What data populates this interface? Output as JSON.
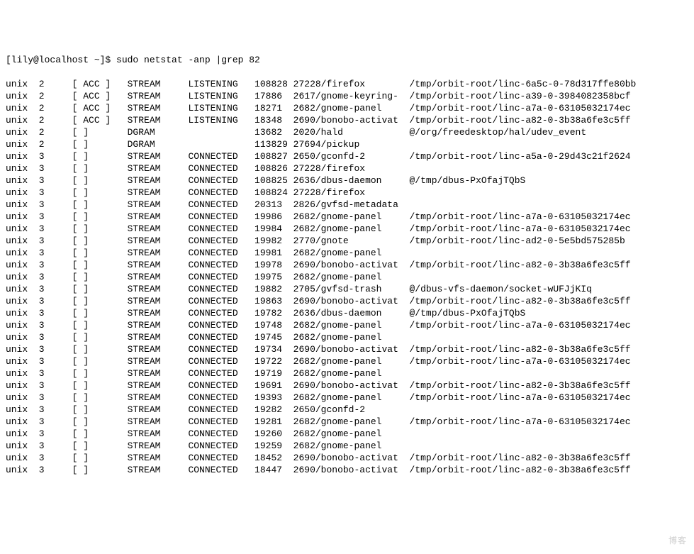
{
  "prompt": "[lily@localhost ~]$ sudo netstat -anp |grep 82",
  "columns": {
    "proto_w": 6,
    "refcnt_w": 3,
    "flags_w": 10,
    "type_w": 11,
    "state_w": 12,
    "inode_w": 7,
    "proc_w": 21
  },
  "rows": [
    {
      "proto": "unix",
      "refcnt": "2",
      "flags": "[ ACC ]",
      "type": "STREAM",
      "state": "LISTENING",
      "inode": "108828",
      "proc": "27228/firefox",
      "path": "/tmp/orbit-root/linc-6a5c-0-78d317ffe80bb"
    },
    {
      "proto": "unix",
      "refcnt": "2",
      "flags": "[ ACC ]",
      "type": "STREAM",
      "state": "LISTENING",
      "inode": "17886",
      "proc": "2617/gnome-keyring-",
      "path": "/tmp/orbit-root/linc-a39-0-3984082358bcf"
    },
    {
      "proto": "unix",
      "refcnt": "2",
      "flags": "[ ACC ]",
      "type": "STREAM",
      "state": "LISTENING",
      "inode": "18271",
      "proc": "2682/gnome-panel",
      "path": "/tmp/orbit-root/linc-a7a-0-63105032174ec"
    },
    {
      "proto": "unix",
      "refcnt": "2",
      "flags": "[ ACC ]",
      "type": "STREAM",
      "state": "LISTENING",
      "inode": "18348",
      "proc": "2690/bonobo-activat",
      "path": "/tmp/orbit-root/linc-a82-0-3b38a6fe3c5ff"
    },
    {
      "proto": "unix",
      "refcnt": "2",
      "flags": "[ ]",
      "type": "DGRAM",
      "state": "",
      "inode": "13682",
      "proc": "2020/hald",
      "path": "@/org/freedesktop/hal/udev_event"
    },
    {
      "proto": "unix",
      "refcnt": "2",
      "flags": "[ ]",
      "type": "DGRAM",
      "state": "",
      "inode": "113829",
      "proc": "27694/pickup",
      "path": ""
    },
    {
      "proto": "unix",
      "refcnt": "3",
      "flags": "[ ]",
      "type": "STREAM",
      "state": "CONNECTED",
      "inode": "108827",
      "proc": "2650/gconfd-2",
      "path": "/tmp/orbit-root/linc-a5a-0-29d43c21f2624"
    },
    {
      "proto": "unix",
      "refcnt": "3",
      "flags": "[ ]",
      "type": "STREAM",
      "state": "CONNECTED",
      "inode": "108826",
      "proc": "27228/firefox",
      "path": ""
    },
    {
      "proto": "unix",
      "refcnt": "3",
      "flags": "[ ]",
      "type": "STREAM",
      "state": "CONNECTED",
      "inode": "108825",
      "proc": "2636/dbus-daemon",
      "path": "@/tmp/dbus-PxOfajTQbS"
    },
    {
      "proto": "unix",
      "refcnt": "3",
      "flags": "[ ]",
      "type": "STREAM",
      "state": "CONNECTED",
      "inode": "108824",
      "proc": "27228/firefox",
      "path": ""
    },
    {
      "proto": "unix",
      "refcnt": "3",
      "flags": "[ ]",
      "type": "STREAM",
      "state": "CONNECTED",
      "inode": "20313",
      "proc": "2826/gvfsd-metadata",
      "path": ""
    },
    {
      "proto": "unix",
      "refcnt": "3",
      "flags": "[ ]",
      "type": "STREAM",
      "state": "CONNECTED",
      "inode": "19986",
      "proc": "2682/gnome-panel",
      "path": "/tmp/orbit-root/linc-a7a-0-63105032174ec"
    },
    {
      "proto": "unix",
      "refcnt": "3",
      "flags": "[ ]",
      "type": "STREAM",
      "state": "CONNECTED",
      "inode": "19984",
      "proc": "2682/gnome-panel",
      "path": "/tmp/orbit-root/linc-a7a-0-63105032174ec"
    },
    {
      "proto": "unix",
      "refcnt": "3",
      "flags": "[ ]",
      "type": "STREAM",
      "state": "CONNECTED",
      "inode": "19982",
      "proc": "2770/gnote",
      "path": "/tmp/orbit-root/linc-ad2-0-5e5bd575285b"
    },
    {
      "proto": "unix",
      "refcnt": "3",
      "flags": "[ ]",
      "type": "STREAM",
      "state": "CONNECTED",
      "inode": "19981",
      "proc": "2682/gnome-panel",
      "path": ""
    },
    {
      "proto": "unix",
      "refcnt": "3",
      "flags": "[ ]",
      "type": "STREAM",
      "state": "CONNECTED",
      "inode": "19978",
      "proc": "2690/bonobo-activat",
      "path": "/tmp/orbit-root/linc-a82-0-3b38a6fe3c5ff"
    },
    {
      "proto": "unix",
      "refcnt": "3",
      "flags": "[ ]",
      "type": "STREAM",
      "state": "CONNECTED",
      "inode": "19975",
      "proc": "2682/gnome-panel",
      "path": ""
    },
    {
      "proto": "unix",
      "refcnt": "3",
      "flags": "[ ]",
      "type": "STREAM",
      "state": "CONNECTED",
      "inode": "19882",
      "proc": "2705/gvfsd-trash",
      "path": "@/dbus-vfs-daemon/socket-wUFJjKIq"
    },
    {
      "proto": "unix",
      "refcnt": "3",
      "flags": "[ ]",
      "type": "STREAM",
      "state": "CONNECTED",
      "inode": "19863",
      "proc": "2690/bonobo-activat",
      "path": "/tmp/orbit-root/linc-a82-0-3b38a6fe3c5ff"
    },
    {
      "proto": "unix",
      "refcnt": "3",
      "flags": "[ ]",
      "type": "STREAM",
      "state": "CONNECTED",
      "inode": "19782",
      "proc": "2636/dbus-daemon",
      "path": "@/tmp/dbus-PxOfajTQbS"
    },
    {
      "proto": "unix",
      "refcnt": "3",
      "flags": "[ ]",
      "type": "STREAM",
      "state": "CONNECTED",
      "inode": "19748",
      "proc": "2682/gnome-panel",
      "path": "/tmp/orbit-root/linc-a7a-0-63105032174ec"
    },
    {
      "proto": "unix",
      "refcnt": "3",
      "flags": "[ ]",
      "type": "STREAM",
      "state": "CONNECTED",
      "inode": "19745",
      "proc": "2682/gnome-panel",
      "path": ""
    },
    {
      "proto": "unix",
      "refcnt": "3",
      "flags": "[ ]",
      "type": "STREAM",
      "state": "CONNECTED",
      "inode": "19734",
      "proc": "2690/bonobo-activat",
      "path": "/tmp/orbit-root/linc-a82-0-3b38a6fe3c5ff"
    },
    {
      "proto": "unix",
      "refcnt": "3",
      "flags": "[ ]",
      "type": "STREAM",
      "state": "CONNECTED",
      "inode": "19722",
      "proc": "2682/gnome-panel",
      "path": "/tmp/orbit-root/linc-a7a-0-63105032174ec"
    },
    {
      "proto": "unix",
      "refcnt": "3",
      "flags": "[ ]",
      "type": "STREAM",
      "state": "CONNECTED",
      "inode": "19719",
      "proc": "2682/gnome-panel",
      "path": ""
    },
    {
      "proto": "unix",
      "refcnt": "3",
      "flags": "[ ]",
      "type": "STREAM",
      "state": "CONNECTED",
      "inode": "19691",
      "proc": "2690/bonobo-activat",
      "path": "/tmp/orbit-root/linc-a82-0-3b38a6fe3c5ff"
    },
    {
      "proto": "unix",
      "refcnt": "3",
      "flags": "[ ]",
      "type": "STREAM",
      "state": "CONNECTED",
      "inode": "19393",
      "proc": "2682/gnome-panel",
      "path": "/tmp/orbit-root/linc-a7a-0-63105032174ec"
    },
    {
      "proto": "unix",
      "refcnt": "3",
      "flags": "[ ]",
      "type": "STREAM",
      "state": "CONNECTED",
      "inode": "19282",
      "proc": "2650/gconfd-2",
      "path": ""
    },
    {
      "proto": "unix",
      "refcnt": "3",
      "flags": "[ ]",
      "type": "STREAM",
      "state": "CONNECTED",
      "inode": "19281",
      "proc": "2682/gnome-panel",
      "path": "/tmp/orbit-root/linc-a7a-0-63105032174ec"
    },
    {
      "proto": "unix",
      "refcnt": "3",
      "flags": "[ ]",
      "type": "STREAM",
      "state": "CONNECTED",
      "inode": "19260",
      "proc": "2682/gnome-panel",
      "path": ""
    },
    {
      "proto": "unix",
      "refcnt": "3",
      "flags": "[ ]",
      "type": "STREAM",
      "state": "CONNECTED",
      "inode": "19259",
      "proc": "2682/gnome-panel",
      "path": ""
    },
    {
      "proto": "unix",
      "refcnt": "3",
      "flags": "[ ]",
      "type": "STREAM",
      "state": "CONNECTED",
      "inode": "18452",
      "proc": "2690/bonobo-activat",
      "path": "/tmp/orbit-root/linc-a82-0-3b38a6fe3c5ff"
    },
    {
      "proto": "unix",
      "refcnt": "3",
      "flags": "[ ]",
      "type": "STREAM",
      "state": "CONNECTED",
      "inode": "18447",
      "proc": "2690/bonobo-activat",
      "path": "/tmp/orbit-root/linc-a82-0-3b38a6fe3c5ff"
    }
  ],
  "watermark": "博客"
}
